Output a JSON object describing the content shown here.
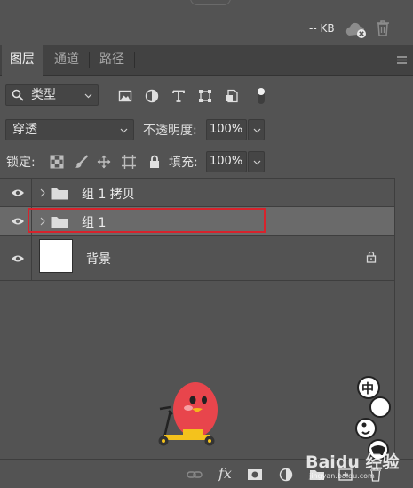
{
  "header": {
    "doc_size": "-- KB"
  },
  "tabs": [
    {
      "label": "图层",
      "active": true
    },
    {
      "label": "通道",
      "active": false
    },
    {
      "label": "路径",
      "active": false
    }
  ],
  "filter": {
    "kind": "类型",
    "icons": [
      "image-filter-icon",
      "adjustment-filter-icon",
      "type-filter-icon",
      "shape-filter-icon",
      "smart-object-filter-icon"
    ]
  },
  "blend": {
    "mode": "穿透",
    "opacity_label": "不透明度:",
    "opacity_value": "100%"
  },
  "lock": {
    "label": "锁定:",
    "fill_label": "填充:",
    "fill_value": "100%"
  },
  "layers": [
    {
      "name": "组 1 拷贝",
      "type": "group",
      "selected": false
    },
    {
      "name": "组 1",
      "type": "group",
      "selected": true
    },
    {
      "name": "背景",
      "type": "background",
      "locked": true
    }
  ],
  "bottom_icons": [
    "link-layers-icon",
    "fx-icon",
    "layer-mask-icon",
    "adjustment-layer-icon",
    "new-group-icon",
    "new-layer-icon",
    "delete-layer-icon"
  ],
  "overlay": {
    "fx_label": "fx",
    "ime_glyph": "中",
    "watermark": "Baidu 经验",
    "watermark_url": "jingyan.baidu.com"
  },
  "colors": {
    "panel": "#535353",
    "selected_row": "#6a6a6a",
    "highlight": "#d7232c"
  }
}
